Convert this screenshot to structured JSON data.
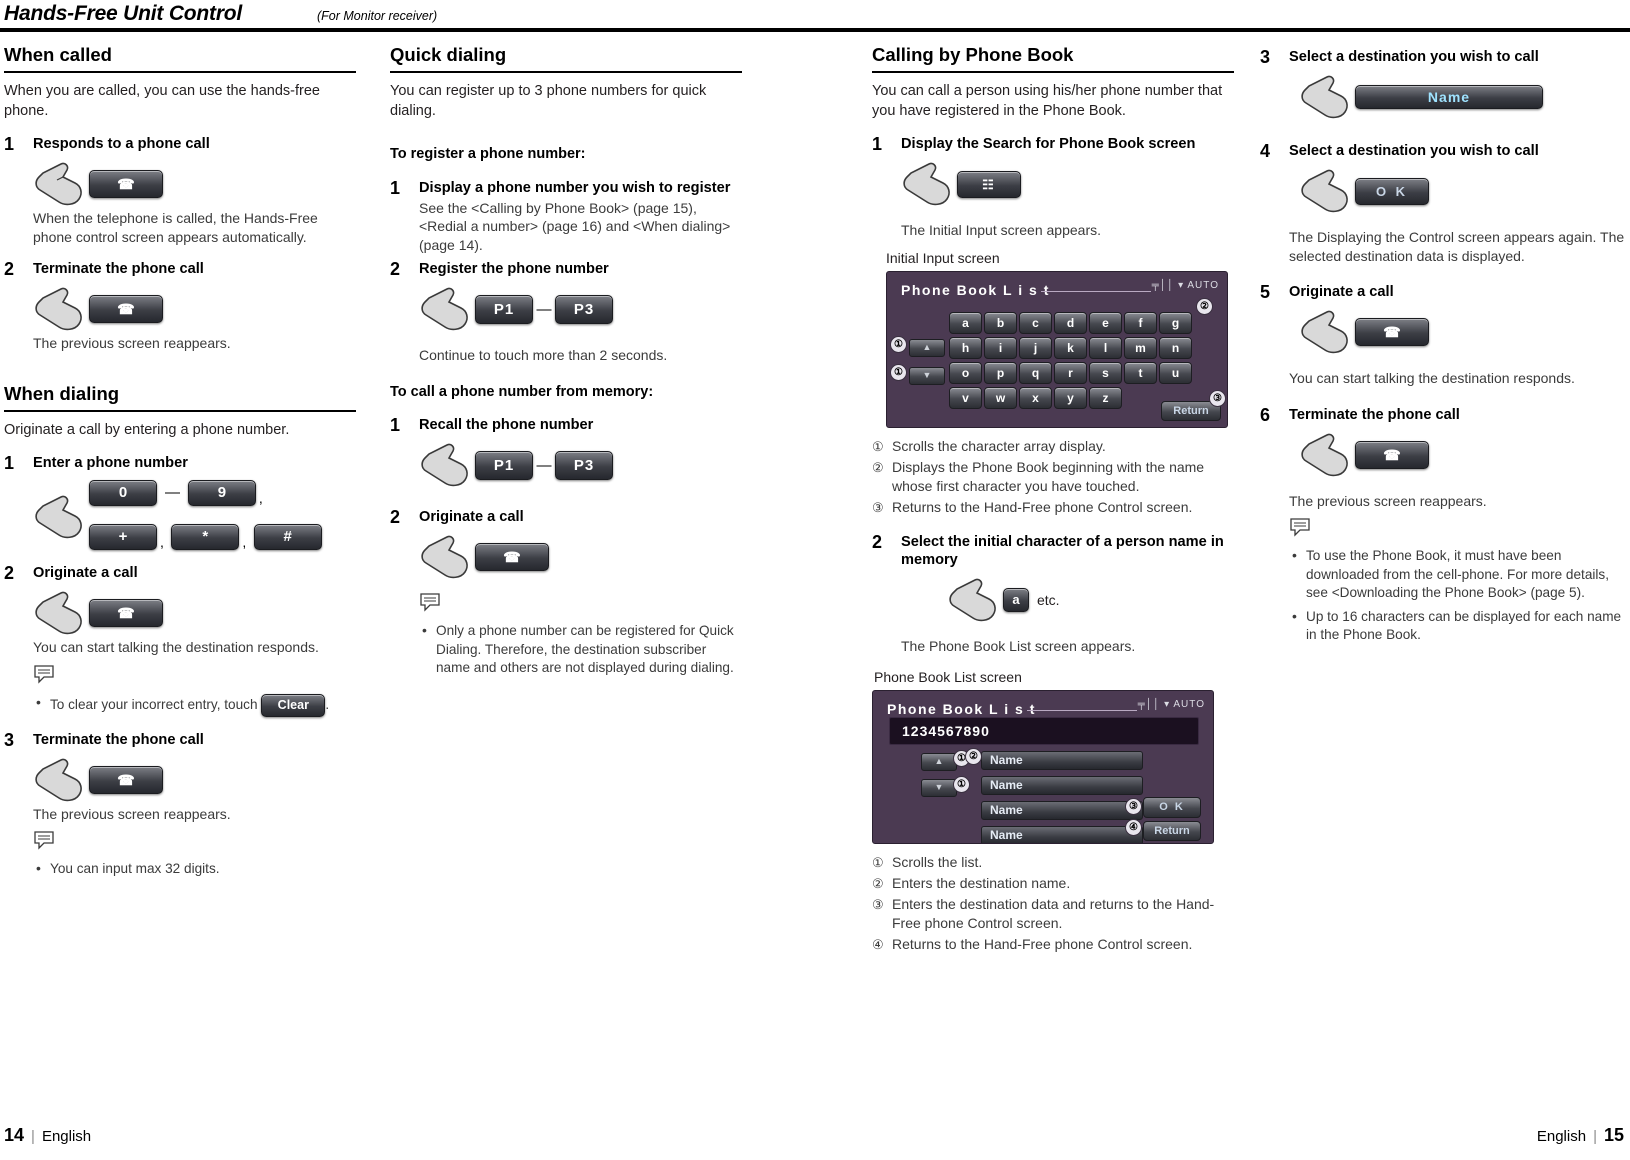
{
  "header": {
    "title": "Hands-Free Unit Control",
    "subtitle": "(For Monitor receiver)"
  },
  "col1": {
    "section1_title": "When called",
    "section1_intro": "When you are called, you can use the hands-free phone.",
    "s1_step1_num": "1",
    "s1_step1_title": "Responds to a phone call",
    "s1_step1_btn": "☎",
    "s1_step1_note": "When the telephone is called, the Hands-Free phone control screen appears automatically.",
    "s1_step2_num": "2",
    "s1_step2_title": "Terminate the phone call",
    "s1_step2_btn": "☎",
    "s1_step2_note": "The previous screen reappears.",
    "section2_title": "When dialing",
    "section2_intro": "Originate a call by entering a phone number.",
    "s2_step1_num": "1",
    "s2_step1_title": "Enter a phone number",
    "key_0": "0",
    "key_9": "9",
    "key_plus": "+",
    "key_star": "*",
    "key_hash": "#",
    "dash": "—",
    "comma": ",",
    "s2_step2_num": "2",
    "s2_step2_title": "Originate a call",
    "s2_step2_btn": "☎",
    "s2_step2_note": "You can start talking the destination responds.",
    "bullet_clear_pre": "To clear your incorrect entry, touch",
    "bullet_clear_btn": "Clear",
    "bullet_clear_post": ".",
    "s2_step3_num": "3",
    "s2_step3_title": "Terminate the phone call",
    "s2_step3_btn": "☎",
    "s2_step3_note": "The previous screen reappears.",
    "bullet_digits": "You can input max 32 digits."
  },
  "col2": {
    "section_title": "Quick dialing",
    "intro": "You can register up to 3 phone numbers for quick dialing.",
    "sub1": "To register a phone number:",
    "step1_num": "1",
    "step1_title": "Display a phone number you wish to register",
    "step1_note": "See the <Calling by Phone Book> (page 15), <Redial a number> (page 16) and <When dialing> (page 14).",
    "step2_num": "2",
    "step2_title": "Register the phone number",
    "p1": "P1",
    "p3": "P3",
    "dash": "—",
    "step2_note": "Continue to touch more than 2 seconds.",
    "sub2": "To call a phone number from memory:",
    "step3_num": "1",
    "step3_title": "Recall the phone number",
    "step4_num": "2",
    "step4_title": "Originate a call",
    "step4_btn": "☎",
    "bullet": "Only a phone number can be registered for Quick Dialing. Therefore, the destination subscriber name and others are not displayed during dialing."
  },
  "col3": {
    "section_title": "Calling by Phone Book",
    "intro": "You can call a person using his/her phone number that you have registered in the Phone Book.",
    "step1_num": "1",
    "step1_title": "Display the Search for Phone Book screen",
    "step1_btn": "☷",
    "step1_note": "The Initial Input screen appears.",
    "caption1": "Initial Input screen",
    "screen1": {
      "title": "Phone  Book  L i s t",
      "status": "╤││  ▾  AUTO",
      "keys_row1": [
        "a",
        "b",
        "c",
        "d",
        "e",
        "f",
        "g"
      ],
      "keys_row2": [
        "h",
        "i",
        "j",
        "k",
        "l",
        "m",
        "n"
      ],
      "keys_row3": [
        "o",
        "p",
        "q",
        "r",
        "s",
        "t",
        "u"
      ],
      "keys_row4": [
        "v",
        "w",
        "x",
        "y",
        "z"
      ],
      "return_label": "Return",
      "callouts": [
        "①",
        "①",
        "②",
        "③"
      ]
    },
    "legend1": [
      {
        "n": "①",
        "t": "Scrolls the character array display."
      },
      {
        "n": "②",
        "t": "Displays the Phone Book beginning with the name whose first character you have touched."
      },
      {
        "n": "③",
        "t": "Returns to the Hand-Free phone Control screen."
      }
    ],
    "step2_num": "2",
    "step2_title": "Select the initial character of a person name in memory",
    "step2_btn": "a",
    "step2_etc": "etc.",
    "step2_note": "The Phone Book List screen appears.",
    "caption2": "Phone Book List screen",
    "screen2": {
      "title": "Phone  Book  L i s t",
      "status": "╤││  ▾  AUTO",
      "number": "1234567890",
      "names": [
        "Name",
        "Name",
        "Name",
        "Name"
      ],
      "ok_label": "O K",
      "return_label": "Return",
      "callouts": [
        "①",
        "①",
        "②",
        "③",
        "④"
      ]
    },
    "legend2": [
      {
        "n": "①",
        "t": "Scrolls the list."
      },
      {
        "n": "②",
        "t": "Enters the destination name."
      },
      {
        "n": "③",
        "t": "Enters the destination data and returns to the Hand-Free phone Control screen."
      },
      {
        "n": "④",
        "t": "Returns to the Hand-Free phone Control screen."
      }
    ]
  },
  "col4": {
    "step3_num": "3",
    "step3_title": "Select a destination you wish to call",
    "step3_btn": "Name",
    "step4_num": "4",
    "step4_title": "Select a destination you wish to call",
    "step4_btn": "O K",
    "step4_note": "The Displaying the Control screen appears again. The selected destination data is displayed.",
    "step5_num": "5",
    "step5_title": "Originate a call",
    "step5_btn": "☎",
    "step5_note": "You can start talking the destination responds.",
    "step6_num": "6",
    "step6_title": "Terminate the phone call",
    "step6_btn": "☎",
    "step6_note": "The previous screen reappears.",
    "bullet1": "To use the Phone Book, it must have been downloaded from the cell-phone. For more details, see <Downloading the Phone Book> (page 5).",
    "bullet2": "Up to 16 characters can be displayed for each name in the Phone Book."
  },
  "footer": {
    "left_page": "14",
    "left_bar": "|",
    "left_label": "English",
    "right_label": "English",
    "right_bar": "|",
    "right_page": "15"
  }
}
